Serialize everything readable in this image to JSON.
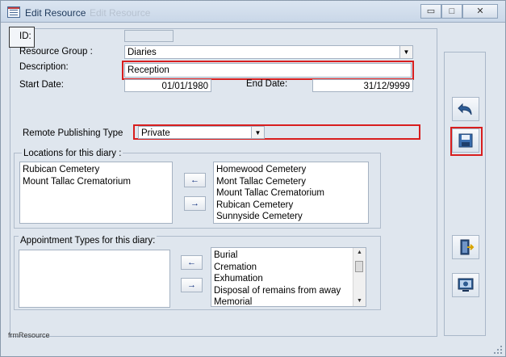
{
  "window": {
    "title": "Edit Resource",
    "ghost_title": "Edit Resource",
    "min_glyph": "▭",
    "max_glyph": "□",
    "close_glyph": "✕"
  },
  "form": {
    "id_label": "ID:",
    "id_value": "",
    "resource_group_label": "Resource Group :",
    "resource_group_value": "Diaries",
    "description_label": "Description:",
    "description_value": "Reception",
    "start_date_label": "Start Date:",
    "start_date_value": "01/01/1980",
    "end_date_label": "End Date:",
    "end_date_value": "31/12/9999",
    "remote_publishing_label": "Remote Publishing Type",
    "remote_publishing_value": "Private"
  },
  "locations": {
    "title": "Locations for this diary :",
    "assigned": [
      "Rubican Cemetery",
      "Mount Tallac Crematorium"
    ],
    "available": [
      "Homewood Cemetery",
      "Mont Tallac Cemetery",
      "Mount Tallac Crematorium",
      "Rubican Cemetery",
      "Sunnyside Cemetery"
    ],
    "move_left_glyph": "←",
    "move_right_glyph": "→"
  },
  "appointment_types": {
    "title": "Appointment Types for this diary:",
    "assigned": [],
    "available": [
      "Burial",
      "Cremation",
      "Exhumation",
      "Disposal of remains from away",
      "Memorial"
    ],
    "move_left_glyph": "←",
    "move_right_glyph": "→"
  },
  "side_buttons": {
    "undo_icon": "undo-icon",
    "save_icon": "save-icon",
    "exit_icon": "exit-door-icon",
    "preview_icon": "preview-icon"
  },
  "footer": {
    "form_name": "frmResource"
  },
  "colors": {
    "highlight": "#d81e1e",
    "form_background": "#dfe6ee",
    "arrow_color": "#0b2a7a"
  }
}
